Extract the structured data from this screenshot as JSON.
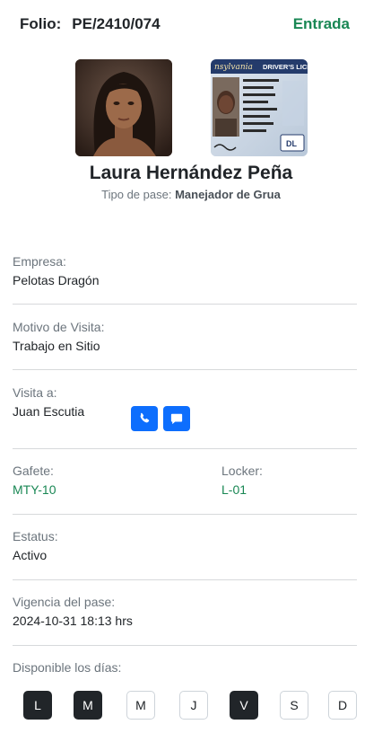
{
  "header": {
    "folio_label": "Folio:",
    "folio_value": "PE/2410/074",
    "movement": "Entrada"
  },
  "visitor": {
    "name": "Laura Hernández Peña",
    "pass_type_label": "Tipo de pase:",
    "pass_type_value": "Manejador de Grua"
  },
  "fields": {
    "company_label": "Empresa:",
    "company_value": "Pelotas Dragón",
    "reason_label": "Motivo de Visita:",
    "reason_value": "Trabajo en Sitio",
    "host_label": "Visita a:",
    "host_value": "Juan Escutia",
    "badge_label": "Gafete:",
    "badge_value": "MTY-10",
    "locker_label": "Locker:",
    "locker_value": "L-01",
    "status_label": "Estatus:",
    "status_value": "Activo",
    "validity_label": "Vigencia del pase:",
    "validity_value": "2024-10-31 18:13 hrs",
    "days_label": "Disponible los días:"
  },
  "days": [
    {
      "label": "L",
      "active": true
    },
    {
      "label": "M",
      "active": true
    },
    {
      "label": "M",
      "active": false
    },
    {
      "label": "J",
      "active": false
    },
    {
      "label": "V",
      "active": true
    },
    {
      "label": "S",
      "active": false
    },
    {
      "label": "D",
      "active": false
    }
  ],
  "id_card": {
    "state_text": "nsylvania",
    "title_text": "DRIVER'S LICE",
    "class_text": "DL"
  },
  "colors": {
    "accent_green": "#198754",
    "button_blue": "#0d6efd",
    "day_active": "#212529"
  },
  "icons": {
    "call": "phone-icon",
    "message": "message-icon"
  }
}
